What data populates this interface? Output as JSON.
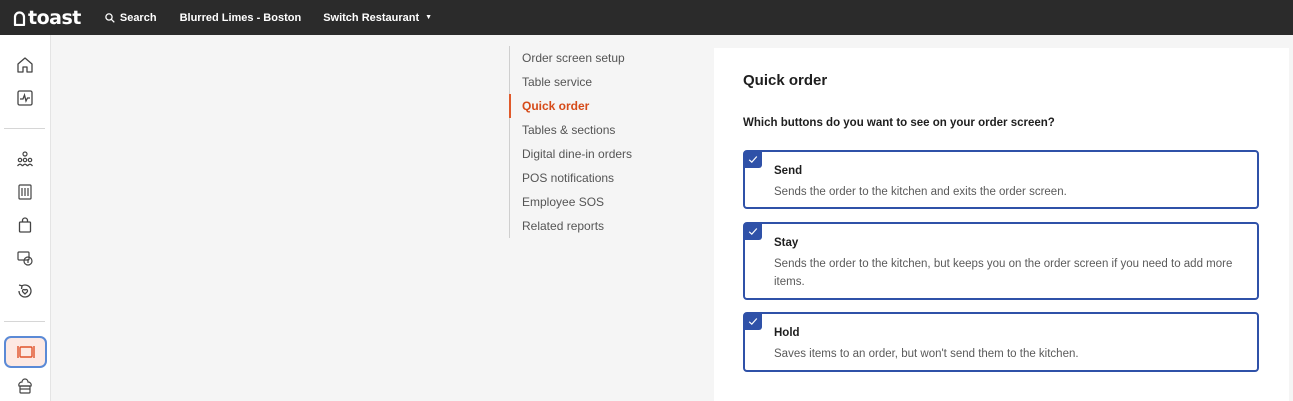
{
  "header": {
    "logo_text": "toast",
    "search_label": "Search",
    "location": "Blurred Limes - Boston",
    "switch_label": "Switch Restaurant",
    "background": "#2b2b2b"
  },
  "sidebar": {
    "icons": [
      "home-icon",
      "activity-icon",
      "org-chart-icon",
      "menu-icon",
      "shopping-bag-icon",
      "payroll-icon",
      "loyalty-icon",
      "restaurant-table-icon",
      "kitchen-icon"
    ],
    "active": "restaurant-table-icon"
  },
  "subnav": {
    "items": [
      "Order screen setup",
      "Table service",
      "Quick order",
      "Tables & sections",
      "Digital dine-in orders",
      "POS notifications",
      "Employee SOS",
      "Related reports"
    ],
    "active_index": 2,
    "active_color": "#d64b19"
  },
  "main": {
    "title": "Quick order",
    "question": "Which buttons do you want to see on your order screen?",
    "options": [
      {
        "title": "Send",
        "description": "Sends the order to the kitchen and exits the order screen.",
        "checked": true
      },
      {
        "title": "Stay",
        "description": "Sends the order to the kitchen, but keeps you on the order screen if you need to add more items.",
        "checked": true
      },
      {
        "title": "Hold",
        "description": "Saves items to an order, but won't send them to the kitchen.",
        "checked": true
      }
    ],
    "accent_color": "#2f51a8"
  }
}
